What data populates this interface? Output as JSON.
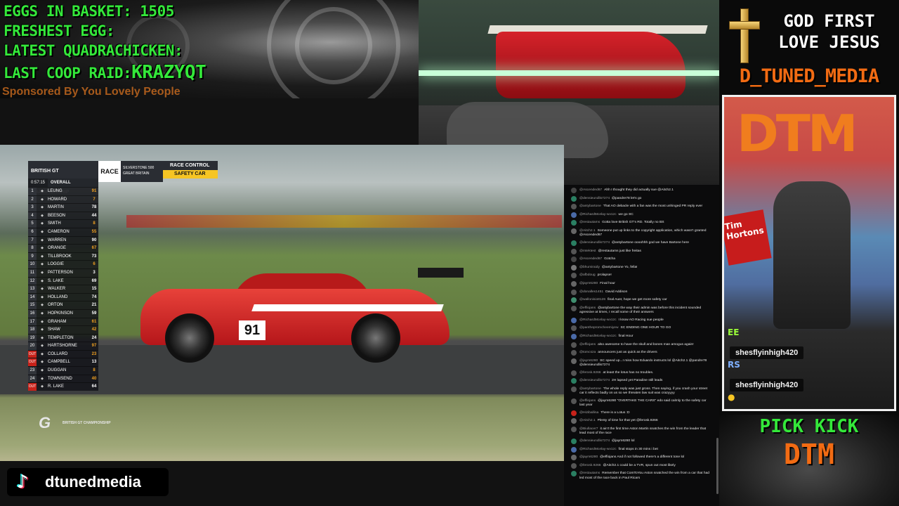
{
  "stats": {
    "eggs_label": "EGGS IN BASKET: 1505",
    "freshest_label": "FRESHEST EGG:",
    "quadrachicken_label": "LATEST QUADRACHICKEN:",
    "coop_raid_label": "LAST COOP RAID:",
    "coop_raid_value": "KRAZYQT",
    "sponsor": "Sponsored By You Lovely People"
  },
  "race_overlay": {
    "championship": "BRITISH GT CHAMPIONSHIP",
    "session": "RACE",
    "venue": "SILVERSTONE 500",
    "country": "GREAT BRITAIN",
    "control_label": "RACE CONTROL",
    "control_status": "SAFETY CAR",
    "timer": "0:57:15",
    "standings_title": "OVERALL",
    "standings": [
      {
        "pos": "1",
        "name": "LEUNG",
        "car": "91",
        "color": "#f0a020"
      },
      {
        "pos": "2",
        "name": "HOWARD",
        "car": "7",
        "color": "#f0a020"
      },
      {
        "pos": "3",
        "name": "MARTIN",
        "car": "78",
        "color": "#ffffff"
      },
      {
        "pos": "4",
        "name": "BEESON",
        "car": "44",
        "color": "#ffffff"
      },
      {
        "pos": "5",
        "name": "SMITH",
        "car": "8",
        "color": "#f0a020"
      },
      {
        "pos": "6",
        "name": "CAMERON",
        "car": "55",
        "color": "#f0a020"
      },
      {
        "pos": "7",
        "name": "WARREN",
        "car": "90",
        "color": "#ffffff"
      },
      {
        "pos": "8",
        "name": "ORANGE",
        "car": "67",
        "color": "#f0a020"
      },
      {
        "pos": "9",
        "name": "TILLBROOK",
        "car": "73",
        "color": "#ffffff"
      },
      {
        "pos": "10",
        "name": "LOGGIE",
        "car": "6",
        "color": "#f0a020"
      },
      {
        "pos": "11",
        "name": "PATTERSON",
        "car": "3",
        "color": "#ffffff"
      },
      {
        "pos": "12",
        "name": "S. LAKE",
        "car": "69",
        "color": "#ffffff"
      },
      {
        "pos": "13",
        "name": "WALKER",
        "car": "15",
        "color": "#ffffff"
      },
      {
        "pos": "14",
        "name": "HOLLAND",
        "car": "74",
        "color": "#ffffff"
      },
      {
        "pos": "15",
        "name": "ORTON",
        "car": "21",
        "color": "#ffffff"
      },
      {
        "pos": "16",
        "name": "HOPKINSON",
        "car": "59",
        "color": "#ffffff"
      },
      {
        "pos": "17",
        "name": "GRAHAM",
        "car": "61",
        "color": "#f0a020"
      },
      {
        "pos": "18",
        "name": "SHAW",
        "car": "42",
        "color": "#f0a020"
      },
      {
        "pos": "19",
        "name": "TEMPLETON",
        "car": "24",
        "color": "#ffffff"
      },
      {
        "pos": "20",
        "name": "HARTSHORNE",
        "car": "97",
        "color": "#f0a020"
      },
      {
        "pos": "OUT",
        "name": "COLLARD",
        "car": "23",
        "color": "#f0a020"
      },
      {
        "pos": "OUT",
        "name": "CAMPBELL",
        "car": "13",
        "color": "#ffffff"
      },
      {
        "pos": "23",
        "name": "DUGGAN",
        "car": "8",
        "color": "#f0a020"
      },
      {
        "pos": "24",
        "name": "TOWNSEND",
        "car": "40",
        "color": "#f0a020"
      },
      {
        "pos": "OUT",
        "name": "R. LAKE",
        "car": "64",
        "color": "#ffffff"
      }
    ],
    "car_number": "91",
    "logo_text": "BRITISH GT CHAMPIONSHIP"
  },
  "tiktok": {
    "icon": "tiktok-icon",
    "handle": "dtunedmedia"
  },
  "chat": [
    {
      "user": "@Ascended67",
      "text": "Ahh I thought they did actually sue @Aitch2.1",
      "av": "#444"
    },
    {
      "user": "@densieundlis7274",
      "text": "@pandre78 let's go",
      "av": "#2a7f62"
    },
    {
      "user": "@antybartone",
      "text": "That AO debacle with a fan was the most unhinged PR reply ever",
      "av": "#555"
    },
    {
      "user": "@RichardMcelay-wv1zc",
      "text": "we go SC",
      "av": "#4a6aa8"
    },
    {
      "user": "@restautams",
      "text": "Gotta love British GT's RD. Totally no BS",
      "av": "#2a7f62"
    },
    {
      "user": "@Aitch2.1",
      "text": "Someone put up links to the copyright application, which wasn't granted @Ascended67",
      "av": "#666"
    },
    {
      "user": "@densieundlis7274",
      "text": "@antybartone oooohhh god we have Bartone here",
      "av": "#2a7f62"
    },
    {
      "user": "@mtektest",
      "text": "@restautams just like freitas",
      "av": "#555"
    },
    {
      "user": "@Ascended67",
      "text": "Gotcha",
      "av": "#444"
    },
    {
      "user": "@bhumiraidy",
      "text": "@antybartone Yo, fella!",
      "av": "#777"
    },
    {
      "user": "@afbdoug",
      "text": "prolapse!",
      "av": "#555"
    },
    {
      "user": "@jaym6280",
      "text": "Final hour",
      "av": "#666"
    },
    {
      "user": "@donalles1451",
      "text": "David Addison",
      "av": "#555"
    },
    {
      "user": "@wallonisio8126",
      "text": "final Auer, hope we get more safety car",
      "av": "#3f8e6e"
    },
    {
      "user": "@effiojans",
      "text": "@antybartone the way their admin was before this incident sounded agressive at times, I recall some of their answers",
      "av": "#555"
    },
    {
      "user": "@RichardMcelay-wv1zc",
      "text": "I know AO Racing sue people",
      "av": "#4a6aa8"
    },
    {
      "user": "@panthepromcheemiyew",
      "text": "SC ENDING ONE HOUR TO GO",
      "av": "#555"
    },
    {
      "user": "@RichardMcelay-wv1zc",
      "text": "final Hour",
      "av": "#4a6aa8"
    },
    {
      "user": "@effiojans",
      "text": "also awesome to have the skull and bones man amogus again!",
      "av": "#555"
    },
    {
      "user": "@tomcsza",
      "text": "announcers just as quick as the drivers",
      "av": "#555"
    },
    {
      "user": "@jaym6280",
      "text": "SC speed up...I miss how Eduardo instructs lol @Aitch2.1 @pandre78 @densieundlis7274",
      "av": "#666"
    },
    {
      "user": "@ferosk.9266",
      "text": "at least the lotus has no troubles.",
      "av": "#555"
    },
    {
      "user": "@densieundlis7274",
      "text": "2H lapsed yet Paradine still leads",
      "av": "#2a7f62"
    },
    {
      "user": "@antybartone",
      "text": "The whole reply was just gross. Then saying, if you crash your street car it reflects badly on us so we threaten law suit was crazyyyy",
      "av": "#555"
    },
    {
      "user": "@effiojans",
      "text": "@jaym6280 \"OVERTAKE THE CARS\" edo said calmly to the safety car last year",
      "av": "#555"
    },
    {
      "user": "@Hiziballina",
      "text": "There is a Lotus :D",
      "av": "#c8221a"
    },
    {
      "user": "@Aitch2.1",
      "text": "Plenty of time for that yet @ferosk.9266",
      "av": "#666"
    },
    {
      "user": "@Biullacer7",
      "text": "it ain't the first time Aston Martin snatches the win from the leader that lead most of the race",
      "av": "#555"
    },
    {
      "user": "@densieundlis7274",
      "text": "@jaym6280 lol",
      "av": "#2a7f62"
    },
    {
      "user": "@RichardMcelay-wv1zc",
      "text": "final stops in 30 mins i bet",
      "av": "#4a6aa8"
    },
    {
      "user": "@jaym6280",
      "text": "@effiojans And if not followed there's a different tone lol",
      "av": "#666"
    },
    {
      "user": "@ferosk.9266",
      "text": "@Aitch2.1 could be a TVR, spun out most likely",
      "av": "#555"
    },
    {
      "user": "@restautams",
      "text": "Remember that ComToYou Aston snatched the win from a car that had led most of the race back in Paul Ricars",
      "av": "#2a7f62"
    }
  ],
  "right_panel": {
    "cross_icon": "cross-icon",
    "faith_line1": "GOD FIRST",
    "faith_line2": "LOVE JESUS",
    "brand": "D_TUNED_MEDIA",
    "facecam_logo": "DTM",
    "sign_text": "Tim Hortons",
    "viewer1": "shesflyinhigh420",
    "viewer2": "shesflyinhigh420",
    "emote1": "EE",
    "emote2": "RS",
    "pick_label": "PICK KICK",
    "pick_name": "DTM"
  },
  "colors": {
    "stat_green": "#34e83a",
    "brand_orange": "#f26b13",
    "safety_yellow": "#f6c524"
  }
}
